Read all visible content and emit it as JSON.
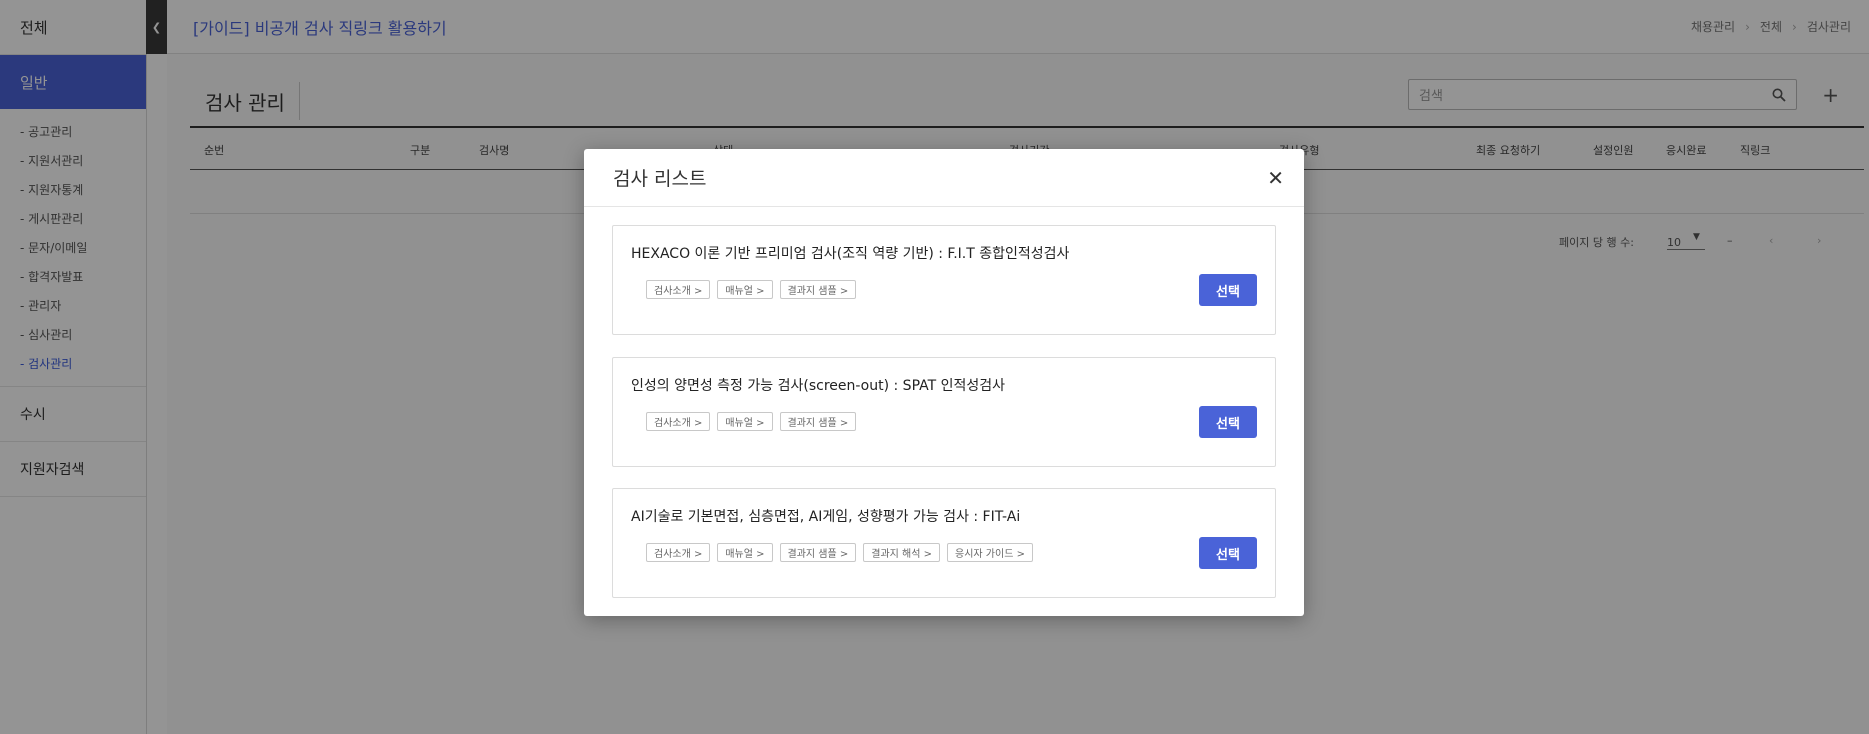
{
  "sidebar": {
    "all_label": "전체",
    "active_label": "일반",
    "items": [
      {
        "label": "- 공고관리"
      },
      {
        "label": "- 지원서관리"
      },
      {
        "label": "- 지원자통계"
      },
      {
        "label": "- 게시판관리"
      },
      {
        "label": "- 문자/이메일"
      },
      {
        "label": "- 합격자발표"
      },
      {
        "label": "- 관리자"
      },
      {
        "label": "- 심사관리"
      },
      {
        "label": "- 검사관리"
      }
    ],
    "section_susi": "수시",
    "section_search": "지원자검색"
  },
  "header": {
    "guide_title": "[가이드] 비공개 검사 직링크 활용하기",
    "breadcrumb": [
      "채용관리",
      "전체",
      "검사관리"
    ]
  },
  "page": {
    "title": "검사 관리",
    "search_placeholder": "검색"
  },
  "table": {
    "columns": [
      "순번",
      "구분",
      "검사명",
      "상태",
      "검사기간",
      "검사유형",
      "최종 요청하기",
      "설정인원",
      "응시완료",
      "직링크"
    ]
  },
  "pager": {
    "rows_label": "페이지 당 행 수:",
    "rows_value": "10",
    "range": "–"
  },
  "modal": {
    "title": "검사 리스트",
    "select_label": "선택",
    "cards": [
      {
        "title": "HEXACO 이론 기반 프리미엄 검사(조직 역량 기반) : F.I.T 종합인적성검사",
        "chips": [
          "검사소개 >",
          "매뉴얼 >",
          "결과지 샘플 >"
        ]
      },
      {
        "title": "인성의 양면성 측정 가능 검사(screen-out) : SPAT 인적성검사",
        "chips": [
          "검사소개 >",
          "매뉴얼 >",
          "결과지 샘플 >"
        ]
      },
      {
        "title": "AI기술로 기본면접, 심층면접, AI게임, 성향평가 가능 검사 : FIT-Ai",
        "chips": [
          "검사소개 >",
          "매뉴얼 >",
          "결과지 샘플 >",
          "결과지 해석 >",
          "응시자 가이드 >"
        ]
      }
    ]
  }
}
